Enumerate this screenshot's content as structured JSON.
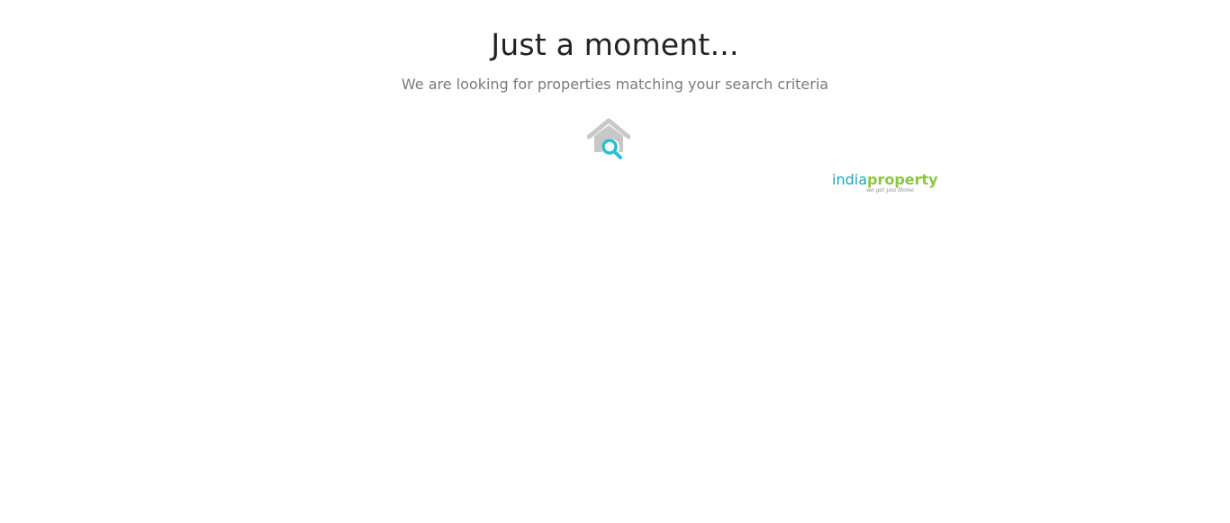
{
  "loading": {
    "title": "Just a moment...",
    "message": "We are looking for properties matching your search criteria",
    "icon": "house-search-icon"
  },
  "brand": {
    "logo_part1": "india",
    "logo_part2": "property",
    "tagline": "we get you Home",
    "primary_color": "#1aa6b7",
    "secondary_color": "#8cc63f"
  },
  "colors": {
    "house_gray": "#c8c8c8",
    "magnifier": "#2bbfcf",
    "title_text": "#222222",
    "subtitle_text": "#7a7a7a"
  }
}
